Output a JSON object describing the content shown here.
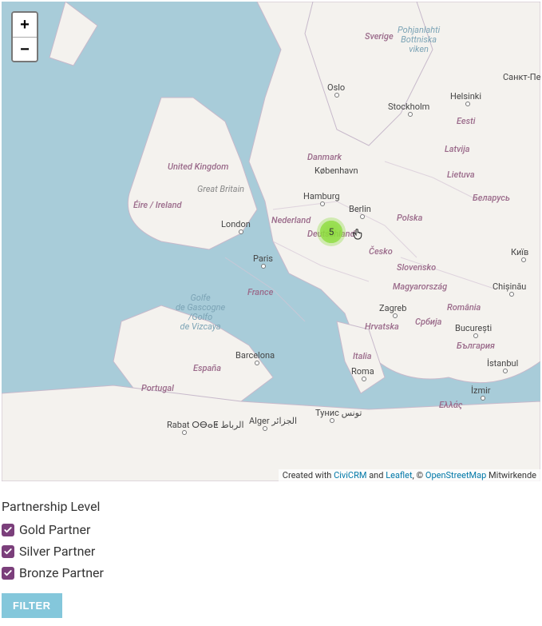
{
  "map": {
    "zoom_in": "+",
    "zoom_out": "−",
    "cluster_count": "5",
    "countries": {
      "uk": "United Kingdom",
      "gb": "Great Britain",
      "ireland": "Éire / Ireland",
      "nederland": "Nederland",
      "deutschland": "Deutschland",
      "danmark": "Danmark",
      "sverige": "Sverige",
      "france": "France",
      "espana": "España",
      "portugal": "Portugal",
      "italia": "Italia",
      "polska": "Polska",
      "cesko": "Česko",
      "slovensko": "Slovensko",
      "magyar": "Magyarország",
      "romania": "România",
      "balgaria": "България",
      "ellada": "Ελλάς",
      "srbija": "Србија",
      "hrvatska": "Hrvatska",
      "lietuva": "Lietuva",
      "latvija": "Latvija",
      "eesti": "Eesti",
      "belarus": "Беларусь",
      "bothnia": "Pohjanlahti\nBottniska\nviken",
      "gascogne": "Golfe\nde Gascogne\n/Golfo\nde Vizcaya"
    },
    "cities": {
      "london": "London",
      "paris": "Paris",
      "berlin": "Berlin",
      "hamburg": "Hamburg",
      "oslo": "Oslo",
      "stockholm": "Stockholm",
      "helsinki": "Helsinki",
      "kobenhavn": "København",
      "barcelona": "Barcelona",
      "roma": "Roma",
      "zagreb": "Zagreb",
      "bucuresti": "București",
      "istanbul": "İstanbul",
      "izmir": "İzmir",
      "tunis": "Тунис تونس",
      "alger": "Alger الجزائر",
      "rabat": "Rabat ⵔⴱⴰⵟ الرباط",
      "kyiv": "Київ",
      "spb": "Санкт-Петербург",
      "chisinau": "Chișinău"
    },
    "attribution": {
      "prefix": "Created with ",
      "civicrm": "CiviCRM",
      "and": " and ",
      "leaflet": "Leaflet",
      "comma": ", © ",
      "osm": "OpenStreetMap",
      "suffix": " Mitwirkende"
    }
  },
  "filter": {
    "title": "Partnership Level",
    "options": [
      {
        "label": "Gold Partner",
        "checked": true
      },
      {
        "label": "Silver Partner",
        "checked": true
      },
      {
        "label": "Bronze Partner",
        "checked": true
      }
    ],
    "button": "FILTER"
  }
}
